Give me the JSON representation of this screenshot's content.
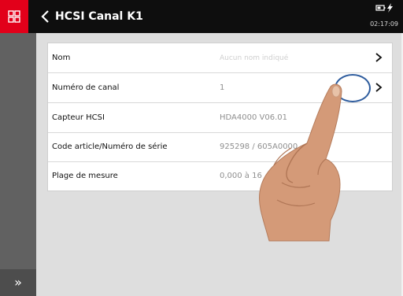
{
  "header": {
    "title": "HCSI Canal K1",
    "clock": "02:17:09"
  },
  "rows": [
    {
      "label": "Nom",
      "value": "Aucun nom indiqué",
      "placeholder": true
    },
    {
      "label": "Numéro de canal",
      "value": "1"
    },
    {
      "label": "Capteur HCSI",
      "value": "HDA4000 V06.01"
    },
    {
      "label": "Code article/Numéro de série",
      "value": "925298 / 605A0000"
    },
    {
      "label": "Plage de mesure",
      "value": "0,000 à 16"
    }
  ],
  "sidebar": {
    "expand_glyph": "»"
  },
  "icons": {
    "apps": "apps-grid-icon",
    "back": "chevron-left-icon",
    "battery": "battery-icon",
    "charging": "lightning-icon",
    "row_arrow": "chevron-right-icon",
    "hand": "pointing-hand"
  },
  "colors": {
    "brand_red": "#e2001a",
    "header": "#0e0e0e",
    "sidebar": "#616161",
    "background": "#dedede",
    "highlight_circle": "#2f5d9e"
  }
}
